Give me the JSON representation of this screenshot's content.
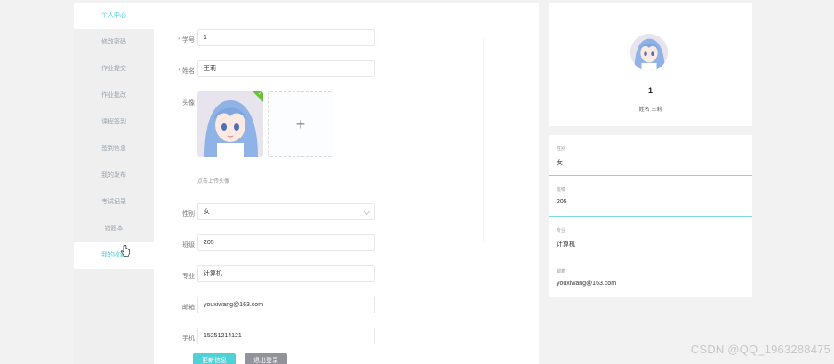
{
  "sidebar": {
    "items": [
      {
        "label": "个人中心"
      },
      {
        "label": "修改密码"
      },
      {
        "label": "作业提交"
      },
      {
        "label": "作业批改"
      },
      {
        "label": "课程签到"
      },
      {
        "label": "签到信息"
      },
      {
        "label": "我的发布"
      },
      {
        "label": "考试记录"
      },
      {
        "label": "错题本"
      },
      {
        "label": "我的收藏"
      }
    ]
  },
  "form": {
    "student_no": {
      "label": "学号",
      "value": "1"
    },
    "name": {
      "label": "姓名",
      "value": "王莉"
    },
    "avatar": {
      "label": "头像",
      "hint": "点击上传头像"
    },
    "gender": {
      "label": "性别",
      "value": "女"
    },
    "class": {
      "label": "班级",
      "value": "205"
    },
    "major": {
      "label": "专业",
      "value": "计算机"
    },
    "email": {
      "label": "邮箱",
      "value": "youxiwang@163.com"
    },
    "phone": {
      "label": "手机",
      "value": "15251214121"
    },
    "update_button": "更新信息",
    "logout_button": "退出登录"
  },
  "profile": {
    "id": "1",
    "name_line": "姓名 王莉"
  },
  "info": [
    {
      "label": "性别",
      "value": "女"
    },
    {
      "label": "班级",
      "value": "205"
    },
    {
      "label": "专业",
      "value": "计算机"
    },
    {
      "label": "邮箱",
      "value": "youxiwang@163.com"
    }
  ],
  "watermark": "CSDN @QQ_1963288475",
  "colors": {
    "accent": "#4ad3d6",
    "success": "#67c23a",
    "required": "#f56c6c"
  }
}
